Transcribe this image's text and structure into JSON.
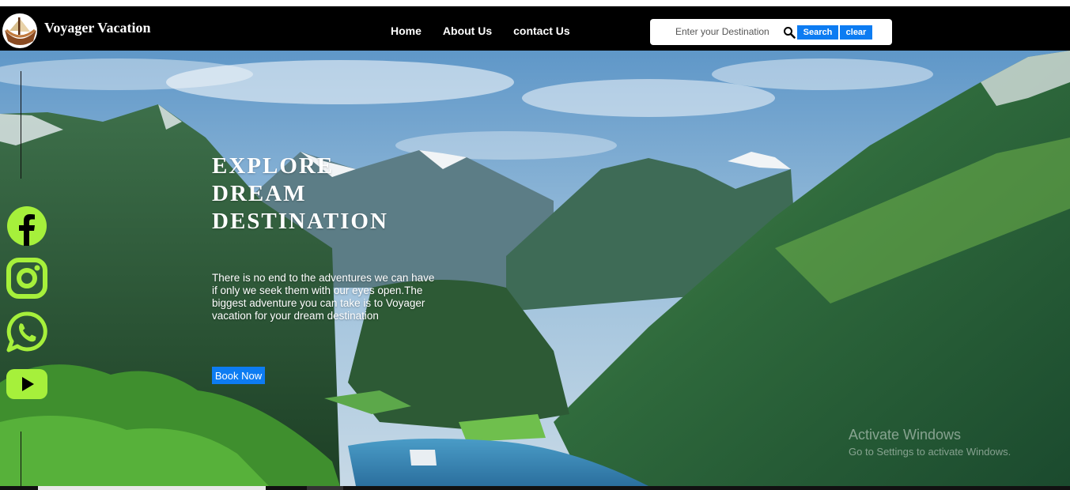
{
  "brand": {
    "name": "Voyager Vacation",
    "logo_icon": "wooden-boat-icon"
  },
  "nav": {
    "links": [
      {
        "label": "Home"
      },
      {
        "label": "About Us"
      },
      {
        "label": "contact Us"
      }
    ]
  },
  "search": {
    "placeholder": "Enter your Destination",
    "value": "",
    "search_label": "Search",
    "clear_label": "clear",
    "icon": "search-icon"
  },
  "hero": {
    "headline": [
      "EXPLORE",
      "DREAM",
      "DESTINATION"
    ],
    "tagline": "There is no end to the adventures we can have if only we seek them with our eyes open.The biggest adventure you can take is to Voyager vacation for your dream destination",
    "cta_label": "Book Now"
  },
  "social": [
    {
      "name": "facebook-icon"
    },
    {
      "name": "instagram-icon"
    },
    {
      "name": "whatsapp-icon"
    },
    {
      "name": "youtube-icon"
    }
  ],
  "watermark": {
    "title": "Activate Windows",
    "subtitle": "Go to Settings to activate Windows."
  },
  "colors": {
    "accent": "#0d7cf2",
    "social": "#a6f03b",
    "navbar": "#000000"
  }
}
